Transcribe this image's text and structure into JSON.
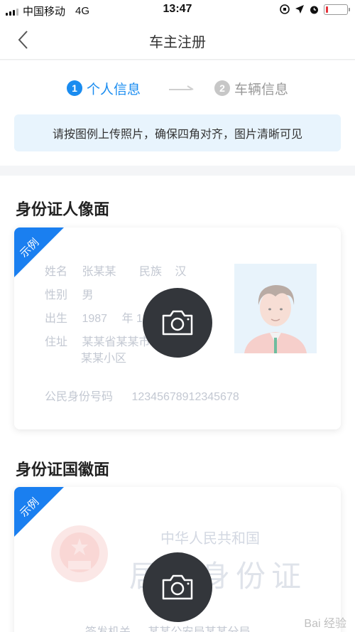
{
  "status_bar": {
    "carrier": "中国移动",
    "network": "4G",
    "time": "13:47",
    "battery_level": 0.12
  },
  "nav": {
    "title": "车主注册",
    "back_icon": "chevron-left-icon"
  },
  "steps": [
    {
      "num": "1",
      "label": "个人信息",
      "active": true
    },
    {
      "num": "2",
      "label": "车辆信息",
      "active": false
    }
  ],
  "notice": "请按图例上传照片，确保四角对齐，图片清晰可见",
  "front": {
    "title": "身份证人像面",
    "ribbon": "示例",
    "name_label": "姓名",
    "name_value": "张某某",
    "ethnic_label": "民族",
    "ethnic_value": "汉",
    "gender_label": "性别",
    "gender_value": "男",
    "birth_label": "出生",
    "birth_year": "1987",
    "birth_month_label": "年 12",
    "address_label": "住址",
    "address_line1": "某某省某某市",
    "address_line2": "某某小区",
    "idnum_label": "公民身份号码",
    "idnum_value": "12345678912345678"
  },
  "back": {
    "title": "身份证国徽面",
    "ribbon": "示例",
    "country": "中华人民共和国",
    "card_name": "居民身份证",
    "authority_label": "签发机关",
    "authority_value": "某某公安局某某分局"
  },
  "watermark": "Bai 经验",
  "colors": {
    "accent": "#1a8cf0",
    "notice_bg": "#e8f4fd",
    "camera_bg": "#33363b"
  }
}
